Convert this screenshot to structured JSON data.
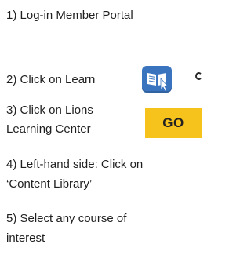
{
  "steps": [
    {
      "text": "1) Log-in  Member Portal"
    },
    {
      "text": "2) Click on Learn"
    },
    {
      "text": "3) Click on Lions"
    },
    {
      "text": "Learning Center"
    },
    {
      "text": "4) Left-hand side: Click on"
    },
    {
      "text": "‘Content Library’"
    },
    {
      "text": "5) Select any course of"
    },
    {
      "text": "interest"
    }
  ],
  "learn_icon": {
    "name": "learn-book-pointer-icon",
    "color": "#3a74bf"
  },
  "go_button": {
    "label": "GO",
    "color": "#f6c21c"
  }
}
